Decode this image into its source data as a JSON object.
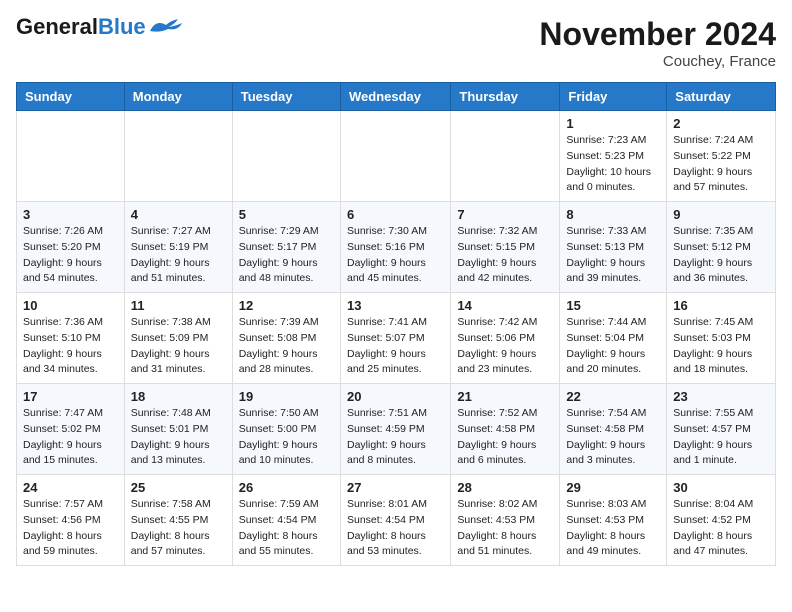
{
  "header": {
    "logo_general": "General",
    "logo_blue": "Blue",
    "month": "November 2024",
    "location": "Couchey, France"
  },
  "days_of_week": [
    "Sunday",
    "Monday",
    "Tuesday",
    "Wednesday",
    "Thursday",
    "Friday",
    "Saturday"
  ],
  "weeks": [
    [
      {
        "day": "",
        "info": ""
      },
      {
        "day": "",
        "info": ""
      },
      {
        "day": "",
        "info": ""
      },
      {
        "day": "",
        "info": ""
      },
      {
        "day": "",
        "info": ""
      },
      {
        "day": "1",
        "info": "Sunrise: 7:23 AM\nSunset: 5:23 PM\nDaylight: 10 hours\nand 0 minutes."
      },
      {
        "day": "2",
        "info": "Sunrise: 7:24 AM\nSunset: 5:22 PM\nDaylight: 9 hours\nand 57 minutes."
      }
    ],
    [
      {
        "day": "3",
        "info": "Sunrise: 7:26 AM\nSunset: 5:20 PM\nDaylight: 9 hours\nand 54 minutes."
      },
      {
        "day": "4",
        "info": "Sunrise: 7:27 AM\nSunset: 5:19 PM\nDaylight: 9 hours\nand 51 minutes."
      },
      {
        "day": "5",
        "info": "Sunrise: 7:29 AM\nSunset: 5:17 PM\nDaylight: 9 hours\nand 48 minutes."
      },
      {
        "day": "6",
        "info": "Sunrise: 7:30 AM\nSunset: 5:16 PM\nDaylight: 9 hours\nand 45 minutes."
      },
      {
        "day": "7",
        "info": "Sunrise: 7:32 AM\nSunset: 5:15 PM\nDaylight: 9 hours\nand 42 minutes."
      },
      {
        "day": "8",
        "info": "Sunrise: 7:33 AM\nSunset: 5:13 PM\nDaylight: 9 hours\nand 39 minutes."
      },
      {
        "day": "9",
        "info": "Sunrise: 7:35 AM\nSunset: 5:12 PM\nDaylight: 9 hours\nand 36 minutes."
      }
    ],
    [
      {
        "day": "10",
        "info": "Sunrise: 7:36 AM\nSunset: 5:10 PM\nDaylight: 9 hours\nand 34 minutes."
      },
      {
        "day": "11",
        "info": "Sunrise: 7:38 AM\nSunset: 5:09 PM\nDaylight: 9 hours\nand 31 minutes."
      },
      {
        "day": "12",
        "info": "Sunrise: 7:39 AM\nSunset: 5:08 PM\nDaylight: 9 hours\nand 28 minutes."
      },
      {
        "day": "13",
        "info": "Sunrise: 7:41 AM\nSunset: 5:07 PM\nDaylight: 9 hours\nand 25 minutes."
      },
      {
        "day": "14",
        "info": "Sunrise: 7:42 AM\nSunset: 5:06 PM\nDaylight: 9 hours\nand 23 minutes."
      },
      {
        "day": "15",
        "info": "Sunrise: 7:44 AM\nSunset: 5:04 PM\nDaylight: 9 hours\nand 20 minutes."
      },
      {
        "day": "16",
        "info": "Sunrise: 7:45 AM\nSunset: 5:03 PM\nDaylight: 9 hours\nand 18 minutes."
      }
    ],
    [
      {
        "day": "17",
        "info": "Sunrise: 7:47 AM\nSunset: 5:02 PM\nDaylight: 9 hours\nand 15 minutes."
      },
      {
        "day": "18",
        "info": "Sunrise: 7:48 AM\nSunset: 5:01 PM\nDaylight: 9 hours\nand 13 minutes."
      },
      {
        "day": "19",
        "info": "Sunrise: 7:50 AM\nSunset: 5:00 PM\nDaylight: 9 hours\nand 10 minutes."
      },
      {
        "day": "20",
        "info": "Sunrise: 7:51 AM\nSunset: 4:59 PM\nDaylight: 9 hours\nand 8 minutes."
      },
      {
        "day": "21",
        "info": "Sunrise: 7:52 AM\nSunset: 4:58 PM\nDaylight: 9 hours\nand 6 minutes."
      },
      {
        "day": "22",
        "info": "Sunrise: 7:54 AM\nSunset: 4:58 PM\nDaylight: 9 hours\nand 3 minutes."
      },
      {
        "day": "23",
        "info": "Sunrise: 7:55 AM\nSunset: 4:57 PM\nDaylight: 9 hours\nand 1 minute."
      }
    ],
    [
      {
        "day": "24",
        "info": "Sunrise: 7:57 AM\nSunset: 4:56 PM\nDaylight: 8 hours\nand 59 minutes."
      },
      {
        "day": "25",
        "info": "Sunrise: 7:58 AM\nSunset: 4:55 PM\nDaylight: 8 hours\nand 57 minutes."
      },
      {
        "day": "26",
        "info": "Sunrise: 7:59 AM\nSunset: 4:54 PM\nDaylight: 8 hours\nand 55 minutes."
      },
      {
        "day": "27",
        "info": "Sunrise: 8:01 AM\nSunset: 4:54 PM\nDaylight: 8 hours\nand 53 minutes."
      },
      {
        "day": "28",
        "info": "Sunrise: 8:02 AM\nSunset: 4:53 PM\nDaylight: 8 hours\nand 51 minutes."
      },
      {
        "day": "29",
        "info": "Sunrise: 8:03 AM\nSunset: 4:53 PM\nDaylight: 8 hours\nand 49 minutes."
      },
      {
        "day": "30",
        "info": "Sunrise: 8:04 AM\nSunset: 4:52 PM\nDaylight: 8 hours\nand 47 minutes."
      }
    ]
  ]
}
